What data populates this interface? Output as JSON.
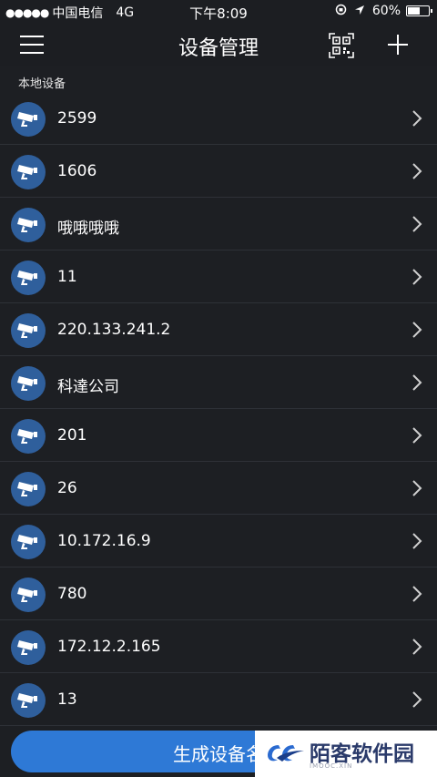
{
  "status_bar": {
    "signal": "●●●●●",
    "carrier": "中国电信",
    "network": "4G",
    "time": "下午8:09",
    "battery_text": "60%",
    "battery_level": 0.6
  },
  "nav": {
    "title": "设备管理"
  },
  "section": {
    "title": "本地设备"
  },
  "devices": [
    {
      "name": "2599"
    },
    {
      "name": "1606"
    },
    {
      "name": "哦哦哦哦"
    },
    {
      "name": "11"
    },
    {
      "name": "220.133.241.2"
    },
    {
      "name": "科達公司"
    },
    {
      "name": "201"
    },
    {
      "name": "26"
    },
    {
      "name": "10.172.16.9"
    },
    {
      "name": "780"
    },
    {
      "name": "172.12.2.165"
    },
    {
      "name": "13"
    }
  ],
  "bottom": {
    "generate_label": "生成设备名"
  },
  "watermark": {
    "text": "陌客软件园",
    "sub": "IMOOC.XIN"
  },
  "colors": {
    "background": "#1d1f23",
    "accent": "#2e79d6",
    "avatar": "#2f5f9c"
  }
}
